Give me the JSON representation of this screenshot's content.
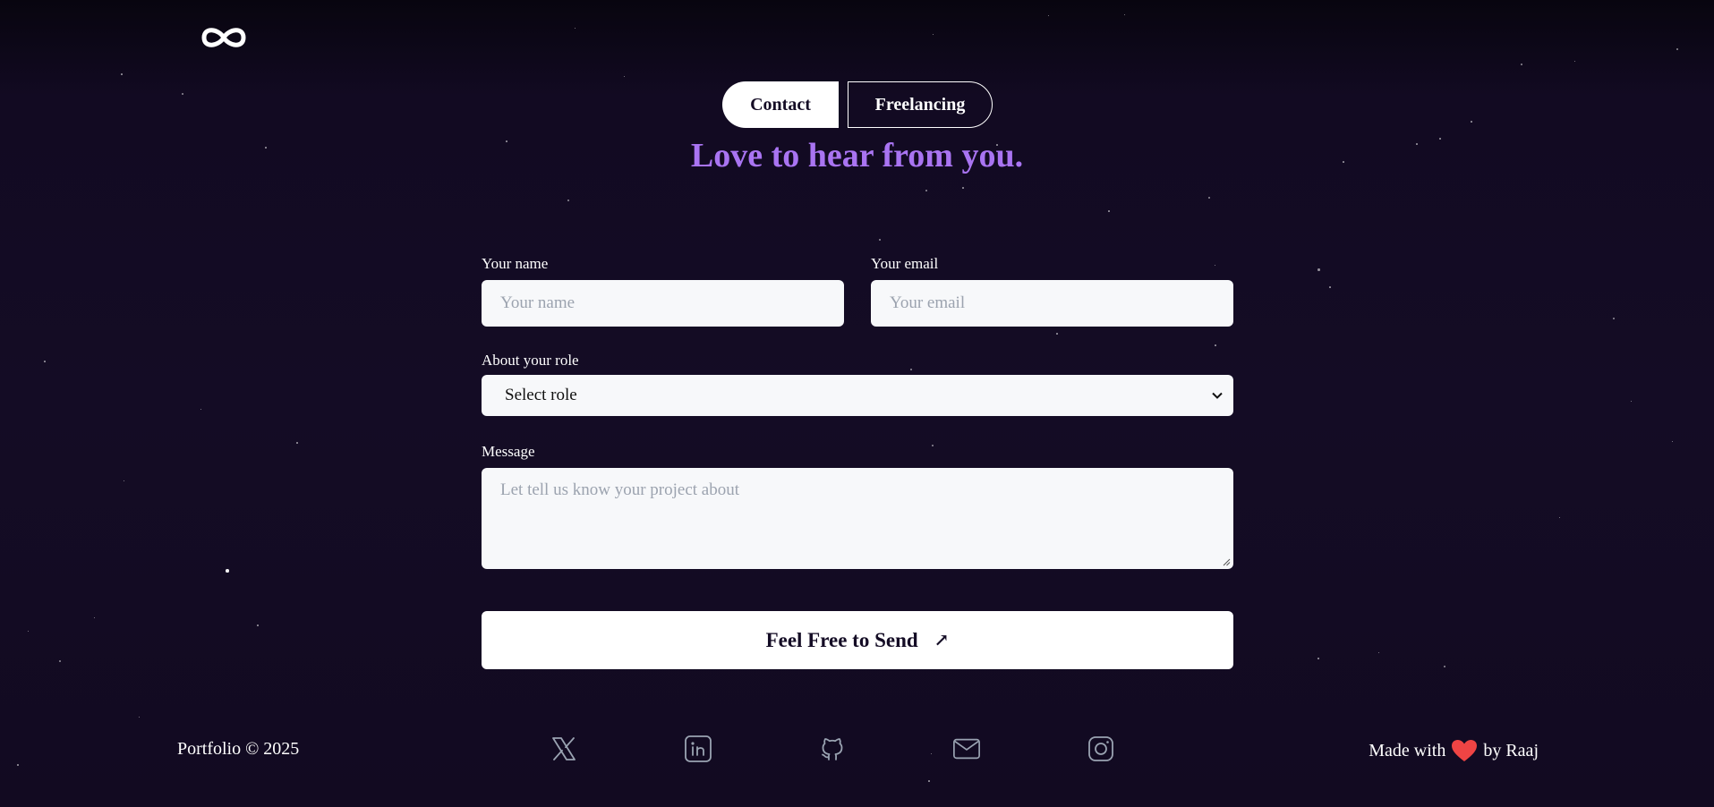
{
  "logo": {
    "icon": "infinity-icon"
  },
  "tabs": [
    {
      "label": "Contact",
      "active": true
    },
    {
      "label": "Freelancing",
      "active": false
    }
  ],
  "heading": "Love to hear from you.",
  "form": {
    "name_label": "Your name",
    "name_placeholder": "Your name",
    "email_label": "Your email",
    "email_placeholder": "Your email",
    "role_label": "About your role",
    "role_selected": "Select role",
    "message_label": "Message",
    "message_placeholder": "Let tell us know your project about",
    "submit_label": "Feel Free to Send",
    "submit_icon": "↗"
  },
  "footer": {
    "copyright": "Portfolio © 2025",
    "made_with": "Made with",
    "by": "by Raaj",
    "heart_color": "#ef4444",
    "socials": [
      "x-icon",
      "linkedin-icon",
      "github-icon",
      "mail-icon",
      "instagram-icon"
    ]
  },
  "colors": {
    "background": "#140c25",
    "accent": "#a974f2",
    "input_bg": "#f7f8fa"
  }
}
